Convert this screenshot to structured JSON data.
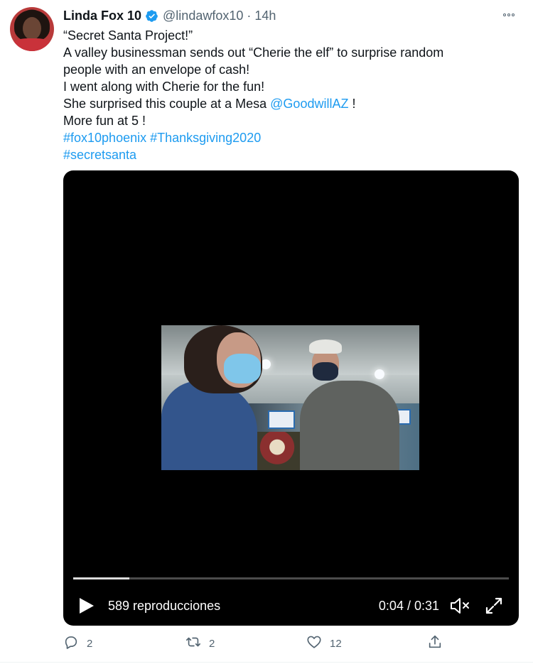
{
  "tweet": {
    "author": {
      "display_name": "Linda Fox 10",
      "handle": "@lindawfox10",
      "verified": true,
      "separator": "·",
      "time": "14h"
    },
    "lines": [
      {
        "text": "“Secret Santa Project!”"
      },
      {
        "text": "A valley businessman sends out “Cherie the elf” to surprise random"
      },
      {
        "text": "people with an envelope of cash!"
      },
      {
        "text": "I went along with Cherie for the fun!"
      },
      {
        "pre": "She surprised this couple at a Mesa ",
        "mention": "@GoodwillAZ",
        "post": " !"
      },
      {
        "text": "More fun at 5 !"
      },
      {
        "hashtags": "#fox10phoenix #Thanksgiving2020"
      },
      {
        "hashtags": "#secretsanta"
      }
    ],
    "video": {
      "views_label": "589 reproducciones",
      "timecode": "0:04 / 0:31",
      "progress_fraction": 0.129,
      "play_icon": "play-icon",
      "mute_icon": "volume-muted-icon",
      "fullscreen_icon": "fullscreen-icon"
    },
    "actions": {
      "reply_count": "2",
      "retweet_count": "2",
      "like_count": "12",
      "share_label": ""
    }
  },
  "colors": {
    "link": "#1d9bf0",
    "secondary_text": "#536471",
    "verified_badge": "#1d9bf0",
    "video_background": "#000000"
  }
}
